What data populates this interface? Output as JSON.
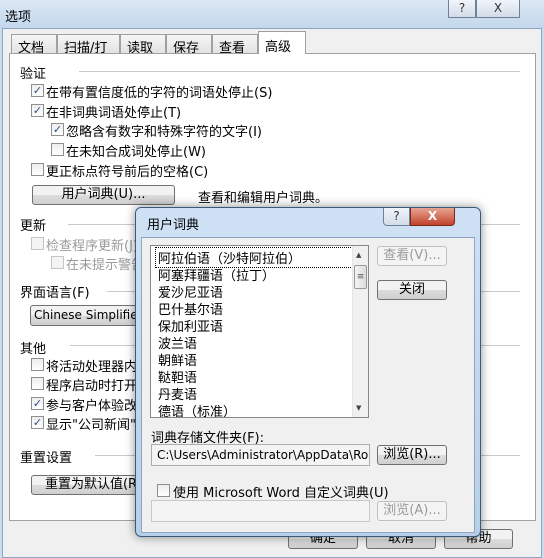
{
  "window": {
    "title": "选项",
    "help_btn": "?",
    "close_btn": "X"
  },
  "tabs": [
    {
      "label": "文档"
    },
    {
      "label": "扫描/打开"
    },
    {
      "label": "读取"
    },
    {
      "label": "保存"
    },
    {
      "label": "查看"
    },
    {
      "label": "高级",
      "active": true
    }
  ],
  "verify": {
    "heading": "验证",
    "items": [
      {
        "label": "在带有置信度低的字符的词语处停止(S)",
        "checked": true
      },
      {
        "label": "在非词典词语处停止(T)",
        "checked": true
      },
      {
        "label": "忽略含有数字和特殊字符的文字(I)",
        "checked": true
      },
      {
        "label": "在未知合成词处停止(W)",
        "checked": false
      },
      {
        "label": "更正标点符号前后的空格(C)",
        "checked": false
      }
    ],
    "user_dict_button": "用户词典(U)...",
    "user_dict_desc": "查看和编辑用户词典。"
  },
  "update": {
    "heading": "更新",
    "items": [
      {
        "label": "检查程序更新(J)",
        "checked": false
      },
      {
        "label": "在未提示警告",
        "checked": false
      }
    ]
  },
  "ui_language": {
    "heading": "界面语言(F)",
    "selected": "Chinese Simplified（简"
  },
  "other": {
    "heading": "其他",
    "items": [
      {
        "label": "将活动处理器内核",
        "checked": false
      },
      {
        "label": "程序启动时打开上",
        "checked": false
      },
      {
        "label": "参与客户体验改进",
        "checked": true
      },
      {
        "label": "显示\"公司新闻\"和",
        "checked": true
      }
    ]
  },
  "reset": {
    "heading": "重置设置",
    "button": "重置为默认值(R"
  },
  "footer": {
    "ok": "确定",
    "cancel": "取消",
    "help": "帮助"
  },
  "dialog": {
    "title": "用户词典",
    "help_btn": "?",
    "close_btn": "X",
    "languages": [
      "阿拉伯语（沙特阿拉伯）",
      "阿塞拜疆语（拉丁）",
      "爱沙尼亚语",
      "巴什基尔语",
      "保加利亚语",
      "波兰语",
      "朝鲜语",
      "鞑靼语",
      "丹麦语",
      "德语（标准）"
    ],
    "view_button": "查看(V)...",
    "close_button": "关闭",
    "folder_label": "词典存储文件夹(F):",
    "folder_path": "C:\\Users\\Administrator\\AppData\\Roaming\\ABE",
    "browse_button": "浏览(R)...",
    "use_word_label": "使用 Microsoft Word 自定义词典(U)",
    "use_word_checked": false,
    "word_path": "",
    "browse_word_button": "浏览(A)..."
  }
}
